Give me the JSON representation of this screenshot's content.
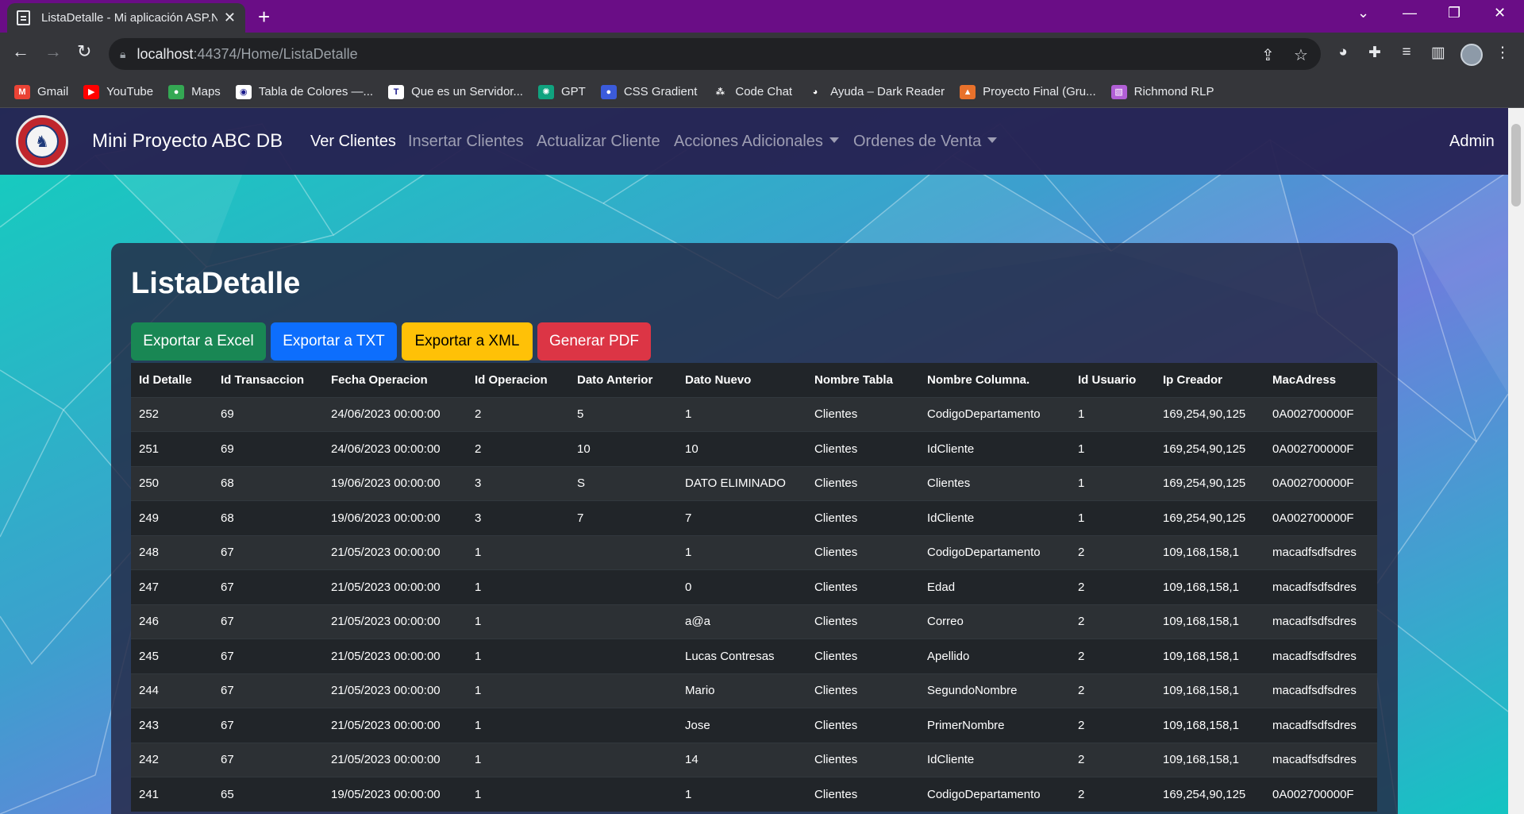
{
  "browser": {
    "tab_title": "ListaDetalle - Mi aplicación ASP.N",
    "url_host": "localhost",
    "url_path": ":44374/Home/ListaDetalle",
    "bookmarks": [
      {
        "label": "Gmail",
        "icon": "gmail-icon",
        "color": "#ea4335",
        "glyph": "M"
      },
      {
        "label": "YouTube",
        "icon": "youtube-icon",
        "color": "#ff0000",
        "glyph": "▶"
      },
      {
        "label": "Maps",
        "icon": "maps-icon",
        "color": "#34a853",
        "glyph": "●"
      },
      {
        "label": "Tabla de Colores —...",
        "icon": "color-table-icon",
        "color": "#ffffff",
        "glyph": "◉"
      },
      {
        "label": "Que es un Servidor...",
        "icon": "t-icon",
        "color": "#ffffff",
        "glyph": "T"
      },
      {
        "label": "GPT",
        "icon": "gpt-icon",
        "color": "#10a37f",
        "glyph": "✺"
      },
      {
        "label": "CSS Gradient",
        "icon": "css-gradient-icon",
        "color": "#3b5bdb",
        "glyph": "●"
      },
      {
        "label": "Code Chat",
        "icon": "code-chat-icon",
        "color": "#35363a",
        "glyph": "⁂"
      },
      {
        "label": "Ayuda – Dark Reader",
        "icon": "dark-reader-icon",
        "color": "#35363a",
        "glyph": "◕"
      },
      {
        "label": "Proyecto Final (Gru...",
        "icon": "proyecto-icon",
        "color": "#e8712b",
        "glyph": "▲"
      },
      {
        "label": "Richmond RLP",
        "icon": "richmond-icon",
        "color": "#b15fd6",
        "glyph": "▧"
      }
    ]
  },
  "navbar": {
    "brand": "Mini Proyecto ABC DB",
    "links": [
      {
        "label": "Ver Clientes",
        "active": true,
        "dropdown": false
      },
      {
        "label": "Insertar Clientes",
        "active": false,
        "dropdown": false
      },
      {
        "label": "Actualizar Cliente",
        "active": false,
        "dropdown": false
      },
      {
        "label": "Acciones Adicionales",
        "active": false,
        "dropdown": true
      },
      {
        "label": "Ordenes de Venta",
        "active": false,
        "dropdown": true
      }
    ],
    "user": "Admin"
  },
  "page": {
    "title": "ListaDetalle",
    "buttons": {
      "excel": "Exportar a Excel",
      "txt": "Exportar a TXT",
      "xml": "Exportar a XML",
      "pdf": "Generar PDF"
    }
  },
  "table": {
    "headers": [
      "Id Detalle",
      "Id Transaccion",
      "Fecha Operacion",
      "Id Operacion",
      "Dato Anterior",
      "Dato Nuevo",
      "Nombre Tabla",
      "Nombre Columna.",
      "Id Usuario",
      "Ip Creador",
      "MacAdress"
    ],
    "rows": [
      [
        "252",
        "69",
        "24/06/2023 00:00:00",
        "2",
        "5",
        "1",
        "Clientes",
        "CodigoDepartamento",
        "1",
        "169,254,90,125",
        "0A002700000F"
      ],
      [
        "251",
        "69",
        "24/06/2023 00:00:00",
        "2",
        "10",
        "10",
        "Clientes",
        "IdCliente",
        "1",
        "169,254,90,125",
        "0A002700000F"
      ],
      [
        "250",
        "68",
        "19/06/2023 00:00:00",
        "3",
        "S",
        "DATO ELIMINADO",
        "Clientes",
        "Clientes",
        "1",
        "169,254,90,125",
        "0A002700000F"
      ],
      [
        "249",
        "68",
        "19/06/2023 00:00:00",
        "3",
        "7",
        "7",
        "Clientes",
        "IdCliente",
        "1",
        "169,254,90,125",
        "0A002700000F"
      ],
      [
        "248",
        "67",
        "21/05/2023 00:00:00",
        "1",
        "",
        "1",
        "Clientes",
        "CodigoDepartamento",
        "2",
        "109,168,158,1",
        "macadfsdfsdres"
      ],
      [
        "247",
        "67",
        "21/05/2023 00:00:00",
        "1",
        "",
        "0",
        "Clientes",
        "Edad",
        "2",
        "109,168,158,1",
        "macadfsdfsdres"
      ],
      [
        "246",
        "67",
        "21/05/2023 00:00:00",
        "1",
        "",
        "a@a",
        "Clientes",
        "Correo",
        "2",
        "109,168,158,1",
        "macadfsdfsdres"
      ],
      [
        "245",
        "67",
        "21/05/2023 00:00:00",
        "1",
        "",
        "Lucas Contresas",
        "Clientes",
        "Apellido",
        "2",
        "109,168,158,1",
        "macadfsdfsdres"
      ],
      [
        "244",
        "67",
        "21/05/2023 00:00:00",
        "1",
        "",
        "Mario",
        "Clientes",
        "SegundoNombre",
        "2",
        "109,168,158,1",
        "macadfsdfsdres"
      ],
      [
        "243",
        "67",
        "21/05/2023 00:00:00",
        "1",
        "",
        "Jose",
        "Clientes",
        "PrimerNombre",
        "2",
        "109,168,158,1",
        "macadfsdfsdres"
      ],
      [
        "242",
        "67",
        "21/05/2023 00:00:00",
        "1",
        "",
        "14",
        "Clientes",
        "IdCliente",
        "2",
        "109,168,158,1",
        "macadfsdfsdres"
      ],
      [
        "241",
        "65",
        "19/05/2023 00:00:00",
        "1",
        "",
        "1",
        "Clientes",
        "CodigoDepartamento",
        "2",
        "169,254,90,125",
        "0A002700000F"
      ]
    ]
  }
}
